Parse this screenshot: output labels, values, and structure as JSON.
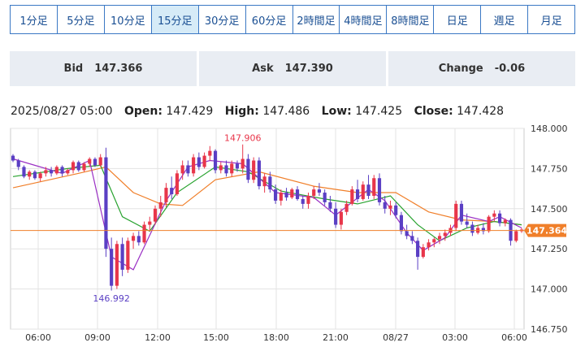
{
  "tabs": [
    {
      "label": "1分足",
      "active": false
    },
    {
      "label": "5分足",
      "active": false
    },
    {
      "label": "10分足",
      "active": false
    },
    {
      "label": "15分足",
      "active": true
    },
    {
      "label": "30分足",
      "active": false
    },
    {
      "label": "60分足",
      "active": false
    },
    {
      "label": "2時間足",
      "active": false
    },
    {
      "label": "4時間足",
      "active": false
    },
    {
      "label": "8時間足",
      "active": false
    },
    {
      "label": "日足",
      "active": false
    },
    {
      "label": "週足",
      "active": false
    },
    {
      "label": "月足",
      "active": false
    }
  ],
  "quotes": {
    "bid_label": "Bid",
    "bid_value": "147.366",
    "ask_label": "Ask",
    "ask_value": "147.390",
    "change_label": "Change",
    "change_value": "-0.06"
  },
  "ohlc": {
    "datetime": "2025/08/27 05:00",
    "open_label": "Open:",
    "open": "147.429",
    "high_label": "High:",
    "high": "147.486",
    "low_label": "Low:",
    "low": "147.425",
    "close_label": "Close:",
    "close": "147.428"
  },
  "chart_data": {
    "type": "candlestick",
    "y_ticks": [
      "148.000",
      "147.750",
      "147.500",
      "147.250",
      "147.000",
      "146.750"
    ],
    "ylim": [
      146.75,
      148.0
    ],
    "x_ticks": [
      "06:00",
      "09:00",
      "12:00",
      "15:00",
      "18:00",
      "21:00",
      "08/27",
      "03:00",
      "06:00"
    ],
    "current_price": "147.364",
    "high_annotation": "147.906",
    "low_annotation": "146.992",
    "colors": {
      "up": "#e8364a",
      "down": "#5a3fc4",
      "ma_short": "#9a2fc4",
      "ma_mid": "#27a22e",
      "ma_long": "#f07f2a",
      "price_line": "#f07f2a",
      "grid": "#e3e3e3"
    },
    "candles": [
      [
        147.83,
        147.84,
        147.79,
        147.8
      ],
      [
        147.8,
        147.81,
        147.74,
        147.76
      ],
      [
        147.76,
        147.77,
        147.69,
        147.7
      ],
      [
        147.7,
        147.74,
        147.68,
        147.73
      ],
      [
        147.73,
        147.74,
        147.68,
        147.69
      ],
      [
        147.69,
        147.73,
        147.67,
        147.72
      ],
      [
        147.72,
        147.76,
        147.7,
        147.74
      ],
      [
        147.74,
        147.76,
        147.7,
        147.72
      ],
      [
        147.72,
        147.77,
        147.71,
        147.76
      ],
      [
        147.76,
        147.77,
        147.7,
        147.72
      ],
      [
        147.72,
        147.75,
        147.71,
        147.74
      ],
      [
        147.74,
        147.8,
        147.72,
        147.79
      ],
      [
        147.79,
        147.8,
        147.73,
        147.74
      ],
      [
        147.74,
        147.79,
        147.73,
        147.78
      ],
      [
        147.78,
        147.82,
        147.76,
        147.81
      ],
      [
        147.81,
        147.82,
        147.76,
        147.77
      ],
      [
        147.77,
        147.84,
        147.76,
        147.82
      ],
      [
        147.82,
        147.88,
        147.2,
        147.25
      ],
      [
        147.25,
        147.32,
        146.99,
        147.02
      ],
      [
        147.02,
        147.3,
        147.0,
        147.28
      ],
      [
        147.28,
        147.32,
        147.08,
        147.12
      ],
      [
        147.12,
        147.32,
        147.1,
        147.3
      ],
      [
        147.3,
        147.35,
        147.25,
        147.33
      ],
      [
        147.33,
        147.36,
        147.27,
        147.29
      ],
      [
        147.29,
        147.42,
        147.28,
        147.4
      ],
      [
        147.4,
        147.45,
        147.36,
        147.42
      ],
      [
        147.42,
        147.52,
        147.4,
        147.5
      ],
      [
        147.5,
        147.58,
        147.45,
        147.54
      ],
      [
        147.54,
        147.66,
        147.51,
        147.63
      ],
      [
        147.63,
        147.7,
        147.56,
        147.59
      ],
      [
        147.59,
        147.74,
        147.58,
        147.72
      ],
      [
        147.72,
        147.8,
        147.68,
        147.77
      ],
      [
        147.77,
        147.8,
        147.7,
        147.72
      ],
      [
        147.72,
        147.84,
        147.7,
        147.82
      ],
      [
        147.82,
        147.85,
        147.74,
        147.76
      ],
      [
        147.76,
        147.85,
        147.75,
        147.83
      ],
      [
        147.83,
        147.89,
        147.8,
        147.86
      ],
      [
        147.86,
        147.87,
        147.72,
        147.74
      ],
      [
        147.74,
        147.79,
        147.72,
        147.77
      ],
      [
        147.77,
        147.8,
        147.7,
        147.72
      ],
      [
        147.72,
        147.8,
        147.7,
        147.78
      ],
      [
        147.78,
        147.8,
        147.73,
        147.75
      ],
      [
        147.75,
        147.9,
        147.72,
        147.81
      ],
      [
        147.81,
        147.84,
        147.66,
        147.68
      ],
      [
        147.68,
        147.82,
        147.66,
        147.8
      ],
      [
        147.8,
        147.82,
        147.62,
        147.64
      ],
      [
        147.64,
        147.72,
        147.6,
        147.7
      ],
      [
        147.7,
        147.73,
        147.6,
        147.62
      ],
      [
        147.62,
        147.65,
        147.53,
        147.55
      ],
      [
        147.55,
        147.62,
        147.52,
        147.6
      ],
      [
        147.6,
        147.63,
        147.55,
        147.57
      ],
      [
        147.57,
        147.63,
        147.56,
        147.62
      ],
      [
        147.62,
        147.64,
        147.55,
        147.56
      ],
      [
        147.56,
        147.58,
        147.5,
        147.53
      ],
      [
        147.53,
        147.6,
        147.5,
        147.58
      ],
      [
        147.58,
        147.64,
        147.56,
        147.62
      ],
      [
        147.62,
        147.66,
        147.58,
        147.6
      ],
      [
        147.6,
        147.62,
        147.52,
        147.54
      ],
      [
        147.54,
        147.58,
        147.48,
        147.5
      ],
      [
        147.5,
        147.54,
        147.38,
        147.4
      ],
      [
        147.4,
        147.5,
        147.37,
        147.48
      ],
      [
        147.48,
        147.55,
        147.46,
        147.53
      ],
      [
        147.53,
        147.64,
        147.52,
        147.62
      ],
      [
        147.62,
        147.68,
        147.54,
        147.56
      ],
      [
        147.56,
        147.67,
        147.55,
        147.65
      ],
      [
        147.65,
        147.71,
        147.56,
        147.58
      ],
      [
        147.58,
        147.71,
        147.56,
        147.69
      ],
      [
        147.69,
        147.72,
        147.52,
        147.54
      ],
      [
        147.54,
        147.58,
        147.47,
        147.5
      ],
      [
        147.5,
        147.55,
        147.46,
        147.52
      ],
      [
        147.52,
        147.54,
        147.44,
        147.46
      ],
      [
        147.46,
        147.48,
        147.34,
        147.36
      ],
      [
        147.36,
        147.4,
        147.31,
        147.33
      ],
      [
        147.33,
        147.36,
        147.28,
        147.3
      ],
      [
        147.3,
        147.32,
        147.12,
        147.2
      ],
      [
        147.2,
        147.28,
        147.19,
        147.26
      ],
      [
        147.26,
        147.31,
        147.24,
        147.29
      ],
      [
        147.29,
        147.32,
        147.26,
        147.31
      ],
      [
        147.31,
        147.35,
        147.28,
        147.33
      ],
      [
        147.33,
        147.37,
        147.3,
        147.35
      ],
      [
        147.35,
        147.4,
        147.33,
        147.38
      ],
      [
        147.38,
        147.55,
        147.36,
        147.53
      ],
      [
        147.53,
        147.55,
        147.4,
        147.42
      ],
      [
        147.42,
        147.47,
        147.38,
        147.4
      ],
      [
        147.4,
        147.42,
        147.33,
        147.35
      ],
      [
        147.35,
        147.4,
        147.34,
        147.38
      ],
      [
        147.38,
        147.41,
        147.34,
        147.36
      ],
      [
        147.36,
        147.46,
        147.35,
        147.45
      ],
      [
        147.45,
        147.49,
        147.42,
        147.47
      ],
      [
        147.47,
        147.49,
        147.39,
        147.41
      ],
      [
        147.41,
        147.44,
        147.39,
        147.43
      ],
      [
        147.43,
        147.44,
        147.27,
        147.3
      ],
      [
        147.3,
        147.37,
        147.29,
        147.36
      ],
      [
        147.36,
        147.38,
        147.35,
        147.37
      ]
    ],
    "ma_short": [
      [
        0,
        147.81
      ],
      [
        9,
        147.72
      ],
      [
        14,
        147.8
      ],
      [
        18,
        147.2
      ],
      [
        22,
        147.12
      ],
      [
        28,
        147.55
      ],
      [
        32,
        147.76
      ],
      [
        36,
        147.8
      ],
      [
        42,
        147.78
      ],
      [
        48,
        147.6
      ],
      [
        55,
        147.57
      ],
      [
        59,
        147.46
      ],
      [
        65,
        147.62
      ],
      [
        68,
        147.55
      ],
      [
        72,
        147.35
      ],
      [
        75,
        147.24
      ],
      [
        79,
        147.32
      ],
      [
        82,
        147.46
      ],
      [
        87,
        147.42
      ],
      [
        89,
        147.45
      ],
      [
        93,
        147.38
      ]
    ],
    "ma_mid": [
      [
        0,
        147.7
      ],
      [
        10,
        147.75
      ],
      [
        16,
        147.77
      ],
      [
        20,
        147.45
      ],
      [
        25,
        147.36
      ],
      [
        30,
        147.6
      ],
      [
        37,
        147.76
      ],
      [
        43,
        147.73
      ],
      [
        49,
        147.61
      ],
      [
        57,
        147.56
      ],
      [
        63,
        147.53
      ],
      [
        69,
        147.58
      ],
      [
        74,
        147.4
      ],
      [
        78,
        147.3
      ],
      [
        83,
        147.38
      ],
      [
        88,
        147.42
      ],
      [
        93,
        147.4
      ]
    ],
    "ma_long": [
      [
        0,
        147.63
      ],
      [
        12,
        147.72
      ],
      [
        17,
        147.76
      ],
      [
        22,
        147.6
      ],
      [
        27,
        147.53
      ],
      [
        31,
        147.52
      ],
      [
        37,
        147.68
      ],
      [
        45,
        147.73
      ],
      [
        55,
        147.64
      ],
      [
        63,
        147.6
      ],
      [
        70,
        147.6
      ],
      [
        76,
        147.48
      ],
      [
        82,
        147.43
      ],
      [
        88,
        147.42
      ],
      [
        93,
        147.4
      ]
    ]
  }
}
